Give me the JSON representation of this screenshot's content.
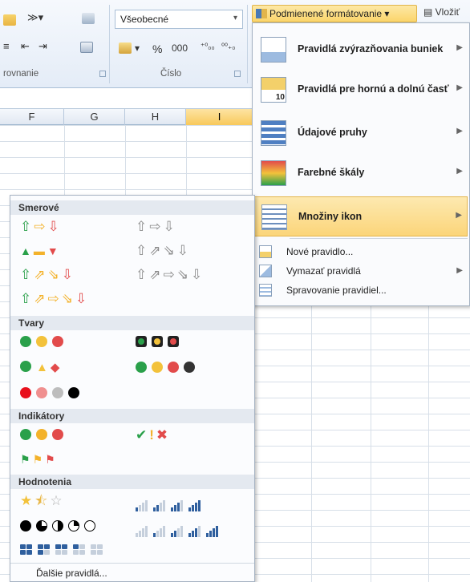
{
  "ribbon": {
    "number_format_value": "Všeobecné",
    "number_symbols": [
      "%",
      "000"
    ],
    "groups": [
      "rovnanie",
      "Číslo"
    ],
    "conditional_formatting_button": "Podmienené formátovanie",
    "insert_button": "Vložiť"
  },
  "columns": [
    "F",
    "G",
    "H",
    "I"
  ],
  "active_column": "I",
  "cf_menu": {
    "items": [
      {
        "label": "Pravidlá zvýrazňovania buniek",
        "submenu": true
      },
      {
        "label": "Pravidlá pre hornú a dolnú časť",
        "submenu": true,
        "badge": "10"
      },
      {
        "label": "Údajové pruhy",
        "submenu": true
      },
      {
        "label": "Farebné škály",
        "submenu": true
      },
      {
        "label": "Množiny ikon",
        "submenu": true,
        "active": true
      }
    ],
    "small_items": [
      {
        "label": "Nové pravidlo...",
        "submenu": false
      },
      {
        "label": "Vymazať pravidlá",
        "submenu": true
      },
      {
        "label": "Spravovanie pravidiel...",
        "submenu": false
      }
    ]
  },
  "icon_sets": {
    "sections": [
      "Smerové",
      "Tvary",
      "Indikátory",
      "Hodnotenia"
    ],
    "more_rules": "Ďalšie pravidlá..."
  },
  "colors": {
    "menu_highlight": "#fbd57a",
    "accent_blue": "#2f5f9e",
    "green": "#2aa04a",
    "yellow": "#f3c23b",
    "red": "#e24b4b"
  }
}
